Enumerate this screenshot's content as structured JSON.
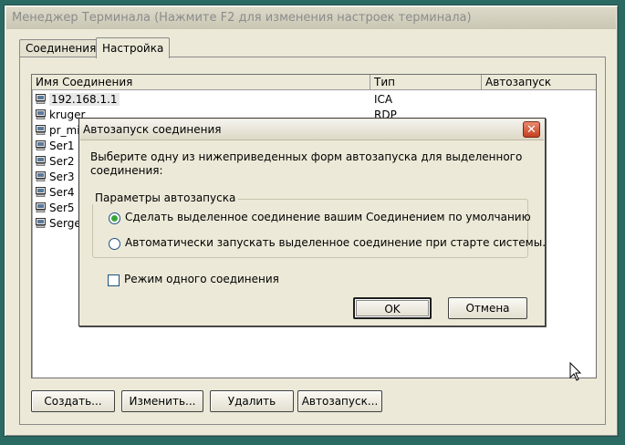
{
  "window": {
    "title": "Менеджер Терминала (Нажмите F2 для изменения настроек терминала)"
  },
  "tabs": [
    {
      "label": "Соединения"
    },
    {
      "label": "Настройка"
    }
  ],
  "list": {
    "columns": [
      "Имя Соединения",
      "Тип",
      "Автозапуск"
    ],
    "rows": [
      {
        "name": "192.168.1.1",
        "type": "ICA",
        "autostart": ""
      },
      {
        "name": "kruger",
        "type": "RDP",
        "autostart": ""
      },
      {
        "name": "pr_mir",
        "type": "",
        "autostart": ""
      },
      {
        "name": "Ser1",
        "type": "",
        "autostart": ""
      },
      {
        "name": "Ser2",
        "type": "",
        "autostart": ""
      },
      {
        "name": "Ser3",
        "type": "",
        "autostart": ""
      },
      {
        "name": "Ser4",
        "type": "",
        "autostart": ""
      },
      {
        "name": "Ser5",
        "type": "",
        "autostart": ""
      },
      {
        "name": "Sergey",
        "type": "",
        "autostart": ""
      }
    ]
  },
  "buttons": {
    "create": "Создать...",
    "edit": "Изменить...",
    "delete": "Удалить",
    "autostart": "Автозапуск..."
  },
  "dialog": {
    "title": "Автозапуск соединения",
    "close_glyph": "✕",
    "description": "Выберите одну из нижеприведенных форм автозапуска для выделенного соединения:",
    "group_label": "Параметры автозапуска",
    "options": [
      {
        "label": "Сделать выделенное соединение вашим Соединением по умолчанию",
        "selected": true
      },
      {
        "label": "Автоматически запускать выделенное соединение при старте системы.",
        "selected": false
      }
    ],
    "single_mode": {
      "label": "Режим одного соединения",
      "checked": false
    },
    "ok": "OK",
    "cancel": "Отмена"
  },
  "colors": {
    "desktop": "#2a6a62",
    "window_bg": "#ece9d8",
    "radio_dot": "#3aa63a",
    "close_red": "#c3401f"
  },
  "icons": {
    "connection": "computer-icon",
    "close": "close-icon",
    "cursor": "mouse-pointer-icon"
  }
}
